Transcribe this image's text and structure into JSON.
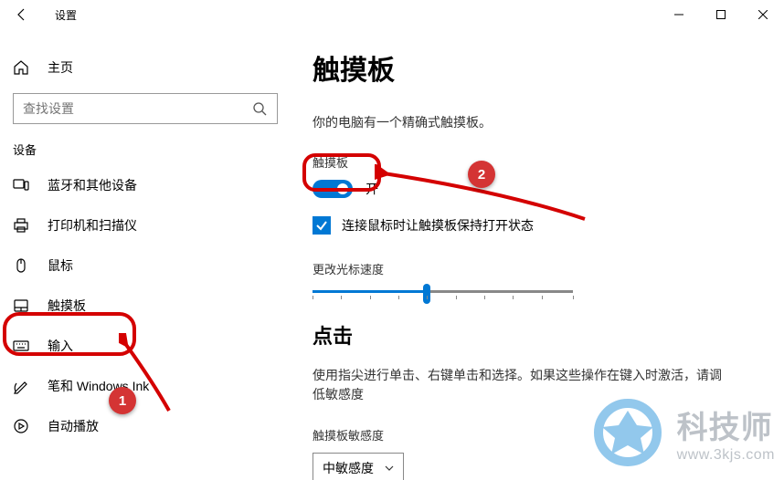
{
  "window": {
    "title": "设置",
    "controls": {
      "minimize": "minimize",
      "maximize": "maximize",
      "close": "close"
    }
  },
  "sidebar": {
    "home_label": "主页",
    "search_placeholder": "查找设置",
    "section_label": "设备",
    "items": [
      {
        "label": "蓝牙和其他设备"
      },
      {
        "label": "打印机和扫描仪"
      },
      {
        "label": "鼠标"
      },
      {
        "label": "触摸板"
      },
      {
        "label": "输入"
      },
      {
        "label": "笔和 Windows Ink"
      },
      {
        "label": "自动播放"
      }
    ]
  },
  "main": {
    "page_title": "触摸板",
    "description": "你的电脑有一个精确式触摸板。",
    "toggle_section_label": "触摸板",
    "toggle_state_label": "开",
    "checkbox_label": "连接鼠标时让触摸板保持打开状态",
    "cursor_speed_label": "更改光标速度",
    "click_title": "点击",
    "click_desc": "使用指尖进行单击、右键单击和选择。如果这些操作在键入时激活，请调低敏感度",
    "sensitivity_label": "触摸板敏感度",
    "sensitivity_value": "中敏感度"
  },
  "annotations": {
    "badge1": "1",
    "badge2": "2"
  },
  "watermark": {
    "title": "科技师",
    "url": "www.3kjs.com"
  }
}
